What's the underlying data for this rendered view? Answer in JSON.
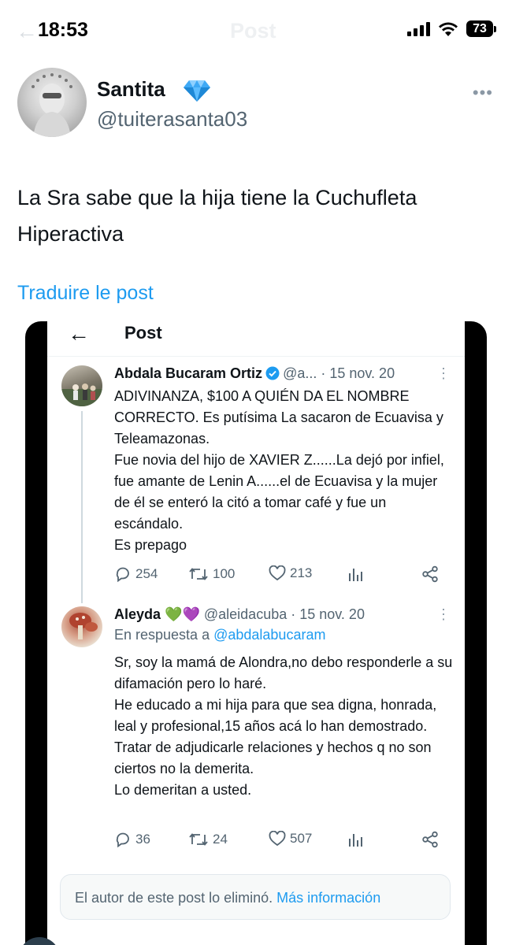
{
  "status_bar": {
    "time": "18:53",
    "ghost_title": "Post",
    "battery": "73"
  },
  "author": {
    "name": "Santita",
    "badge_icon": "diamond-icon",
    "handle": "@tuiterasanta03"
  },
  "post": {
    "text": "La Sra sabe que la hija tiene la Cuchufleta Hiperactiva",
    "translate_label": "Traduire le post"
  },
  "embedded": {
    "title": "Post",
    "tweets": [
      {
        "name": "Abdala Bucaram Ortiz",
        "meta": "@a... · 15 nov. 20",
        "verified": true,
        "body": "ADIVINANZA, $100 A QUIÉN DA EL NOMBRE CORRECTO. Es putísima La sacaron de Ecuavisa y Teleamazonas.\nFue novia del hijo de XAVIER Z......La dejó por infiel, fue amante de Lenin A......el de Ecuavisa y la mujer de él se enteró la citó a tomar café y fue un escándalo.\nEs prepago",
        "replies": "254",
        "retweets": "100",
        "likes": "213"
      },
      {
        "name": "Aleyda 💚💜",
        "meta": "@aleidacuba · 15 nov. 20",
        "reply_prefix": "En respuesta a ",
        "reply_handle": "@abdalabucaram",
        "body": "Sr, soy la mamá de Alondra,no debo responderle a su difamación pero lo haré.\nHe educado a mi hija para que sea digna, honrada, leal y profesional,15 años acá lo han demostrado.\nTratar de adjudicarle relaciones y hechos q no son ciertos no la demerita.\nLo demeritan a usted.",
        "replies": "36",
        "retweets": "24",
        "likes": "507"
      }
    ],
    "deleted_notice": "El autor de este post lo eliminó.",
    "deleted_link": "Más información"
  },
  "colors": {
    "accent": "#1d9bf0",
    "text": "#0f1419",
    "muted": "#536471",
    "verified": "#1d9bf0"
  }
}
